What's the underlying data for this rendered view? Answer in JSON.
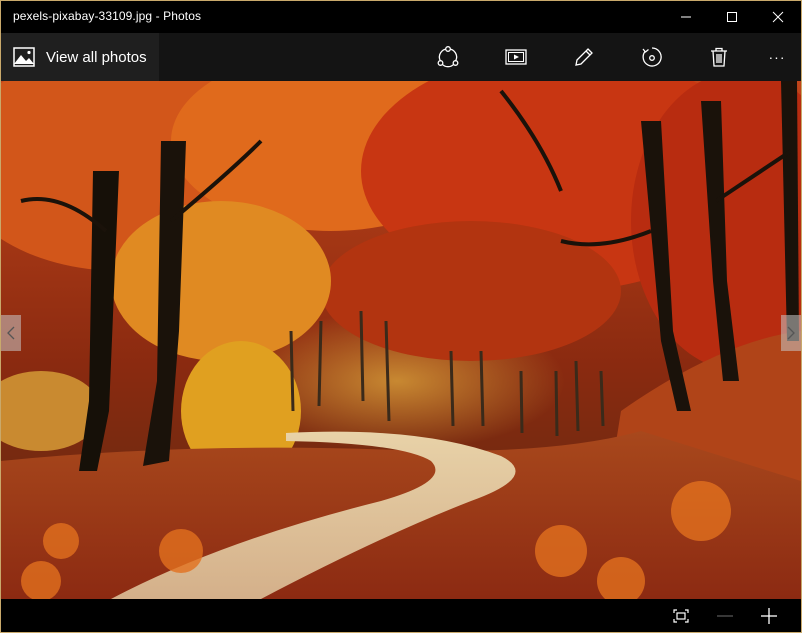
{
  "window": {
    "title": "pexels-pixabay-33109.jpg - Photos"
  },
  "toolbar": {
    "view_all_label": "View all photos",
    "actions": [
      "share-icon",
      "slideshow-icon",
      "edit-icon",
      "rotate-icon",
      "delete-icon",
      "more-icon"
    ],
    "more_label": "···"
  },
  "photo": {
    "description_icon": "autumn-forest-path"
  },
  "bottombar": {
    "controls": [
      "actual-size-icon",
      "zoom-out-icon",
      "zoom-in-icon"
    ]
  },
  "colors": {
    "frame": "#c9a96b",
    "toolbar_bg": "#141414",
    "view_all_bg": "#1f1f1f"
  }
}
